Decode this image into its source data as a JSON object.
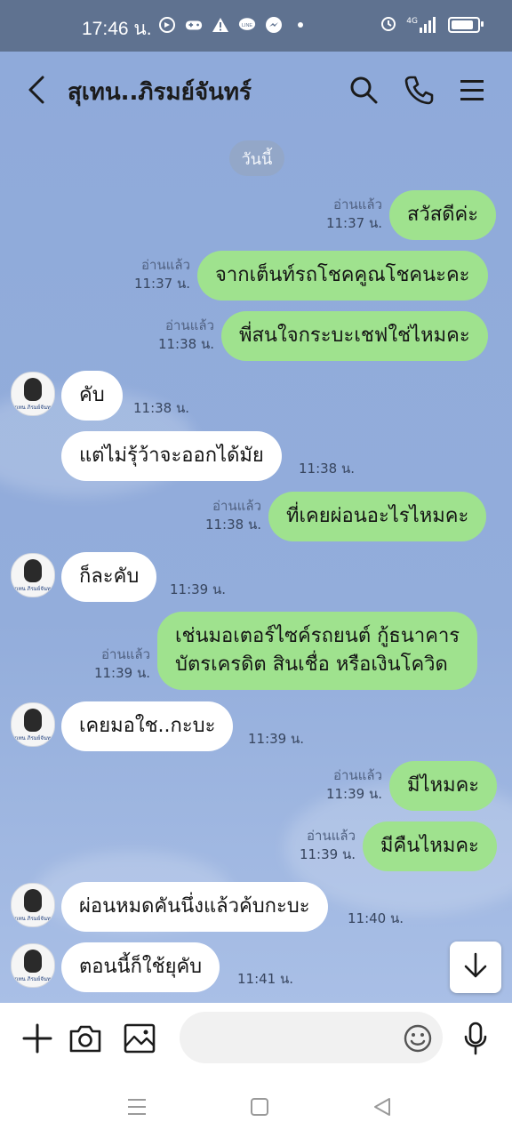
{
  "status_bar": {
    "time": "17:46 น.",
    "network": "4G",
    "icons": [
      "headphone-icon",
      "gamepad-icon",
      "warning-icon",
      "line-icon",
      "messenger-icon",
      "dot-icon"
    ],
    "right_icons": [
      "alarm-icon",
      "signal-icon",
      "battery-icon"
    ]
  },
  "header": {
    "title": "สุเทน..ภิรมย์จันทร์",
    "icons": [
      "back-icon",
      "search-icon",
      "phone-icon",
      "menu-icon"
    ]
  },
  "date_divider": "วันนี้",
  "messages": [
    {
      "from": "me",
      "text": "สวัสดีค่ะ",
      "read": "อ่านแล้ว",
      "time": "11:37 น."
    },
    {
      "from": "me",
      "text": "จากเต็นท์รถโชคคูณโชคนะคะ",
      "read": "อ่านแล้ว",
      "time": "11:37 น."
    },
    {
      "from": "me",
      "text": "พี่สนใจกระบะเชฟใช่ไหมคะ",
      "read": "อ่านแล้ว",
      "time": "11:38 น."
    },
    {
      "from": "them",
      "text": "คับ",
      "time": "11:38 น."
    },
    {
      "from": "them",
      "text": "แต่ไม่รุ้ว้าจะออกได้มัย",
      "time": "11:38 น."
    },
    {
      "from": "me",
      "text": "ที่เคยผ่อนอะไรไหมคะ",
      "read": "อ่านแล้ว",
      "time": "11:38 น."
    },
    {
      "from": "them",
      "text": "ก็ละคับ",
      "time": "11:39 น."
    },
    {
      "from": "me",
      "line1": "เช่นมอเตอร์ไซค์รถยนต์ กู้ธนาคาร",
      "line2": "บัตรเครดิต สินเชื่อ หรือเงินโควิด",
      "read": "อ่านแล้ว",
      "time": "11:39 น."
    },
    {
      "from": "them",
      "text": "เคยมอใช..กะบะ",
      "time": "11:39 น."
    },
    {
      "from": "me",
      "text": "มีไหมคะ",
      "read": "อ่านแล้ว",
      "time": "11:39 น."
    },
    {
      "from": "me",
      "text": "มีคืนไหมคะ",
      "read": "อ่านแล้ว",
      "time": "11:39 น."
    },
    {
      "from": "them",
      "text": "ผ่อนหมดคันนึ่งแล้วค้บกะบะ",
      "time": "11:40 น."
    },
    {
      "from": "them",
      "text": "ตอนนี้ก็ใช้ยุคับ",
      "time": "11:41 น."
    }
  ],
  "avatar_caption": "สุเทน ภิรมย์จันทร์",
  "input_bar": {
    "placeholder": "",
    "icons": [
      "plus-icon",
      "camera-icon",
      "image-icon",
      "emoji-icon",
      "microphone-icon"
    ]
  },
  "colors": {
    "chat_bg": "#8ea9d8",
    "outgoing_bubble": "#9fe28e",
    "incoming_bubble": "#ffffff",
    "status_bar": "#5f7290"
  }
}
